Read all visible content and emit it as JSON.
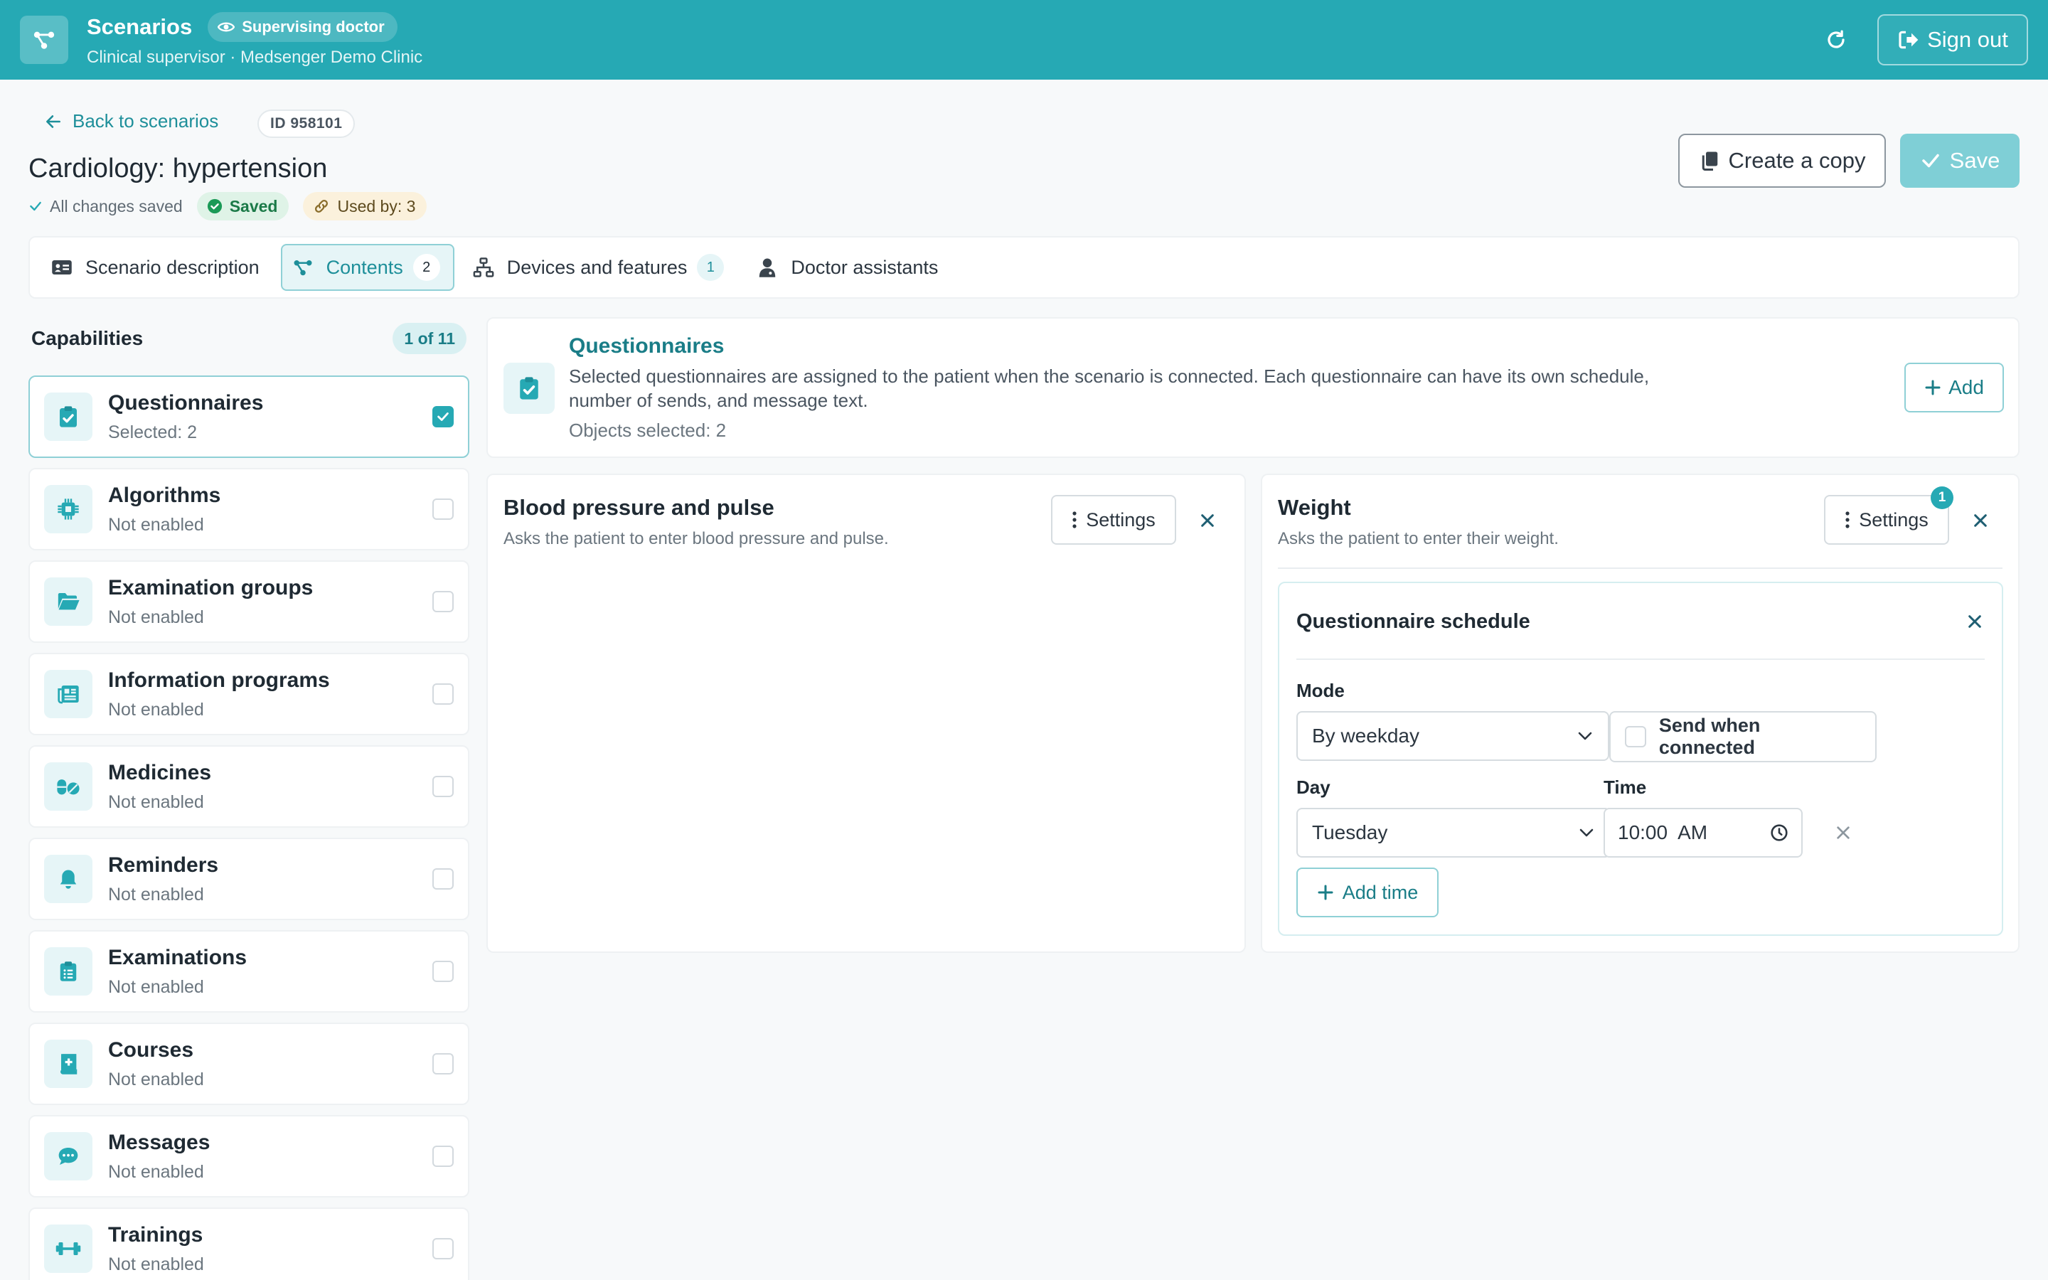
{
  "header": {
    "app_title": "Scenarios",
    "role_badge": "Supervising doctor",
    "subtitle": "Clinical supervisor · Medsenger Demo Clinic",
    "sign_out_label": "Sign out",
    "brand_color": "#26a9b4"
  },
  "page": {
    "back_label": "Back to scenarios",
    "id_label": "ID 958101",
    "title": "Cardiology: hypertension",
    "all_saved": "All changes saved",
    "saved_badge": "Saved",
    "used_by": "Used by: 3",
    "copy_label": "Create a copy",
    "save_label": "Save"
  },
  "tabs": [
    {
      "label": "Scenario description",
      "icon": "id-card-icon",
      "count": null,
      "active": false
    },
    {
      "label": "Contents",
      "icon": "nodes-icon",
      "count": "2",
      "active": true
    },
    {
      "label": "Devices and features",
      "icon": "sitemap-icon",
      "count": "1",
      "active": false
    },
    {
      "label": "Doctor assistants",
      "icon": "user-doctor-icon",
      "count": null,
      "active": false
    }
  ],
  "capabilities": {
    "title": "Capabilities",
    "count": "1 of 11",
    "items": [
      {
        "name": "Questionnaires",
        "status": "Selected: 2",
        "icon": "clipboard-check-icon",
        "checked": true
      },
      {
        "name": "Algorithms",
        "status": "Not enabled",
        "icon": "chip-icon",
        "checked": false
      },
      {
        "name": "Examination groups",
        "status": "Not enabled",
        "icon": "folder-open-icon",
        "checked": false
      },
      {
        "name": "Information programs",
        "status": "Not enabled",
        "icon": "newspaper-icon",
        "checked": false
      },
      {
        "name": "Medicines",
        "status": "Not enabled",
        "icon": "pills-icon",
        "checked": false
      },
      {
        "name": "Reminders",
        "status": "Not enabled",
        "icon": "bell-icon",
        "checked": false
      },
      {
        "name": "Examinations",
        "status": "Not enabled",
        "icon": "clipboard-list-icon",
        "checked": false
      },
      {
        "name": "Courses",
        "status": "Not enabled",
        "icon": "book-medical-icon",
        "checked": false
      },
      {
        "name": "Messages",
        "status": "Not enabled",
        "icon": "comment-dots-icon",
        "checked": false
      },
      {
        "name": "Trainings",
        "status": "Not enabled",
        "icon": "dumbbell-icon",
        "checked": false
      }
    ]
  },
  "section": {
    "title": "Questionnaires",
    "description": "Selected questionnaires are assigned to the patient when the scenario is connected. Each questionnaire can have its own schedule, number of sends, and message text.",
    "selected": "Objects selected: 2",
    "add_label": "Add"
  },
  "questionnaires": [
    {
      "title": "Blood pressure and pulse",
      "description": "Asks the patient to enter blood pressure and pulse.",
      "settings_label": "Settings"
    },
    {
      "title": "Weight",
      "description": "Asks the patient to enter their weight.",
      "settings_label": "Settings",
      "settings_badge": "1",
      "schedule": {
        "title": "Questionnaire schedule",
        "mode_label": "Mode",
        "mode_value": "By weekday",
        "send_when_connected": "Send when connected",
        "day_label": "Day",
        "day_value": "Tuesday",
        "time_label": "Time",
        "time_value": "10:00  AM",
        "add_time_label": "Add time"
      }
    }
  ]
}
